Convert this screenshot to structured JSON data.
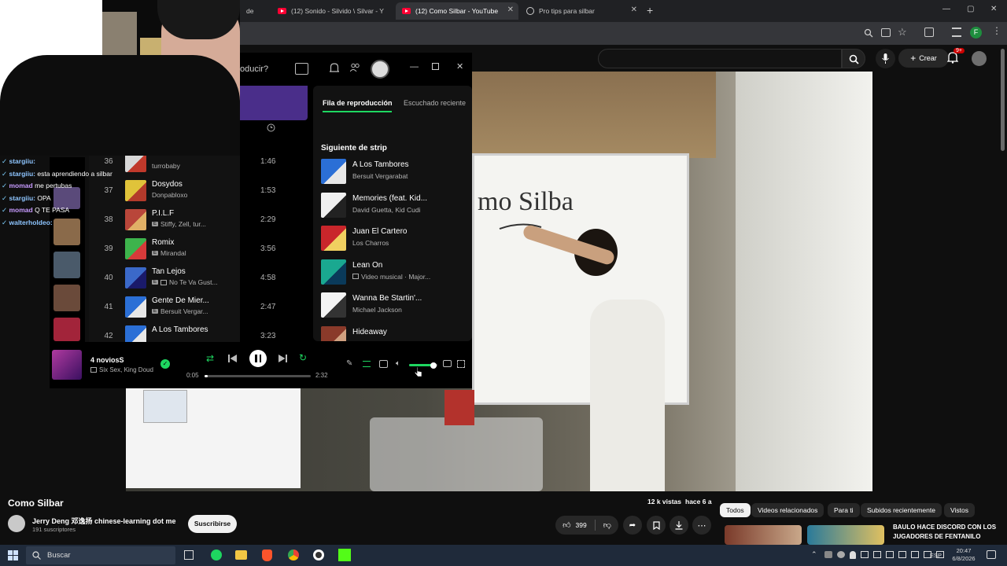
{
  "browser": {
    "tabs": [
      {
        "label": "de",
        "active": false
      },
      {
        "label": "(12) Sonido - Silvido \\ Silvar - Y",
        "active": false
      },
      {
        "label": "(12) Como Silbar - YouTube",
        "active": true
      },
      {
        "label": "Pro tips para silbar",
        "active": false
      }
    ],
    "new_tab": "+",
    "profile_initial": "F"
  },
  "youtube": {
    "create_label": "Crear",
    "notif_count": "9+",
    "video_title": "Como Silbar",
    "views": "12 k vistas",
    "age": "hace 6 a",
    "channel": "Jerry Deng 邓逸扬 chinese-learning dot me",
    "subscribers": "191 suscriptores",
    "subscribe_label": "Suscribirse",
    "likes": "399",
    "chips": [
      "Todos",
      "Videos relacionados",
      "Para ti",
      "Subidos recientemente",
      "Vistos"
    ],
    "rec_title": "BAULO HACE DISCORD CON LOS JUGADORES DE FENTANILO",
    "whiteboard_text": "mo  Silba"
  },
  "spotify": {
    "search_placeholder": "oducir?",
    "queue_tab": "Fila de reproducción",
    "recent_tab": "Escuchado reciente",
    "next_heading": "Siguiente de strip",
    "tracks": [
      {
        "num": "36",
        "title": "",
        "artist": "turrobaby",
        "explicit": false,
        "video": false,
        "duration": "1:46",
        "c1": "#d8d8d8",
        "c2": "#c0392b"
      },
      {
        "num": "37",
        "title": "Dosydos",
        "artist": "Donpabloxo",
        "explicit": false,
        "video": false,
        "duration": "1:53",
        "c1": "#e0c33a",
        "c2": "#b33a2b"
      },
      {
        "num": "38",
        "title": "P.I.L.F",
        "artist": "Stiffy, Zell, tur...",
        "explicit": true,
        "video": false,
        "duration": "2:29",
        "c1": "#b9463a",
        "c2": "#e0b066"
      },
      {
        "num": "39",
        "title": "Romix",
        "artist": "Mirandal",
        "explicit": true,
        "video": false,
        "duration": "3:56",
        "c1": "#3db34c",
        "c2": "#d63a3a"
      },
      {
        "num": "40",
        "title": "Tan Lejos",
        "artist": "No Te Va Gust...",
        "explicit": true,
        "video": true,
        "duration": "4:58",
        "c1": "#3b69c9",
        "c2": "#1a1a6a"
      },
      {
        "num": "41",
        "title": "Gente De Mier...",
        "artist": "Bersuit Vergar...",
        "explicit": true,
        "video": false,
        "duration": "2:47",
        "c1": "#2b6fd6",
        "c2": "#e7e7e7"
      },
      {
        "num": "42",
        "title": "A Los Tambores",
        "artist": "",
        "explicit": false,
        "video": false,
        "duration": "3:23",
        "c1": "#2b6fd6",
        "c2": "#e7e7e7"
      }
    ],
    "queue": [
      {
        "title": "A Los Tambores",
        "artist": "Bersuit Vergarabat",
        "video": false,
        "c1": "#2b6fd6",
        "c2": "#e7e7e7"
      },
      {
        "title": "Memories (feat. Kid...",
        "artist": "David Guetta, Kid Cudi",
        "video": false,
        "c1": "#f0f0f0",
        "c2": "#222"
      },
      {
        "title": "Juan El Cartero",
        "artist": "Los Charros",
        "video": false,
        "c1": "#c9262b",
        "c2": "#f0d060"
      },
      {
        "title": "Lean On",
        "artist": "Video musical · Major...",
        "video": true,
        "c1": "#1aa890",
        "c2": "#0a3a5a"
      },
      {
        "title": "Wanna Be Startin'...",
        "artist": "Michael Jackson",
        "video": false,
        "c1": "#f4f4f4",
        "c2": "#333"
      },
      {
        "title": "Hideaway",
        "artist": "",
        "video": false,
        "c1": "#8a3a2a",
        "c2": "#d0a080"
      }
    ],
    "now_playing": {
      "title": "4 noviosS",
      "artist": "Six Sex, King Doud",
      "elapsed": "0:05",
      "total": "2:32"
    },
    "progress_fraction": 0.033,
    "volume_fraction": 0.85
  },
  "chat": [
    {
      "user": "stargiiu:",
      "text": "",
      "color": "#8ec5ff"
    },
    {
      "user": "stargiiu:",
      "text": "esta aprendiendo a silbar",
      "color": "#8ec5ff"
    },
    {
      "user": "momad",
      "text": "me pertubas",
      "color": "#c79bff"
    },
    {
      "user": "stargiiu:",
      "text": "OPA",
      "color": "#8ec5ff"
    },
    {
      "user": "momad",
      "text": "Q TE PASA",
      "color": "#c79bff"
    },
    {
      "user": "walterholdeo:",
      "text": "",
      "color": "#8ec5ff"
    }
  ],
  "taskbar": {
    "search": "Buscar",
    "lang": "ESP",
    "time": "20:47",
    "date": "6/8/2026"
  }
}
